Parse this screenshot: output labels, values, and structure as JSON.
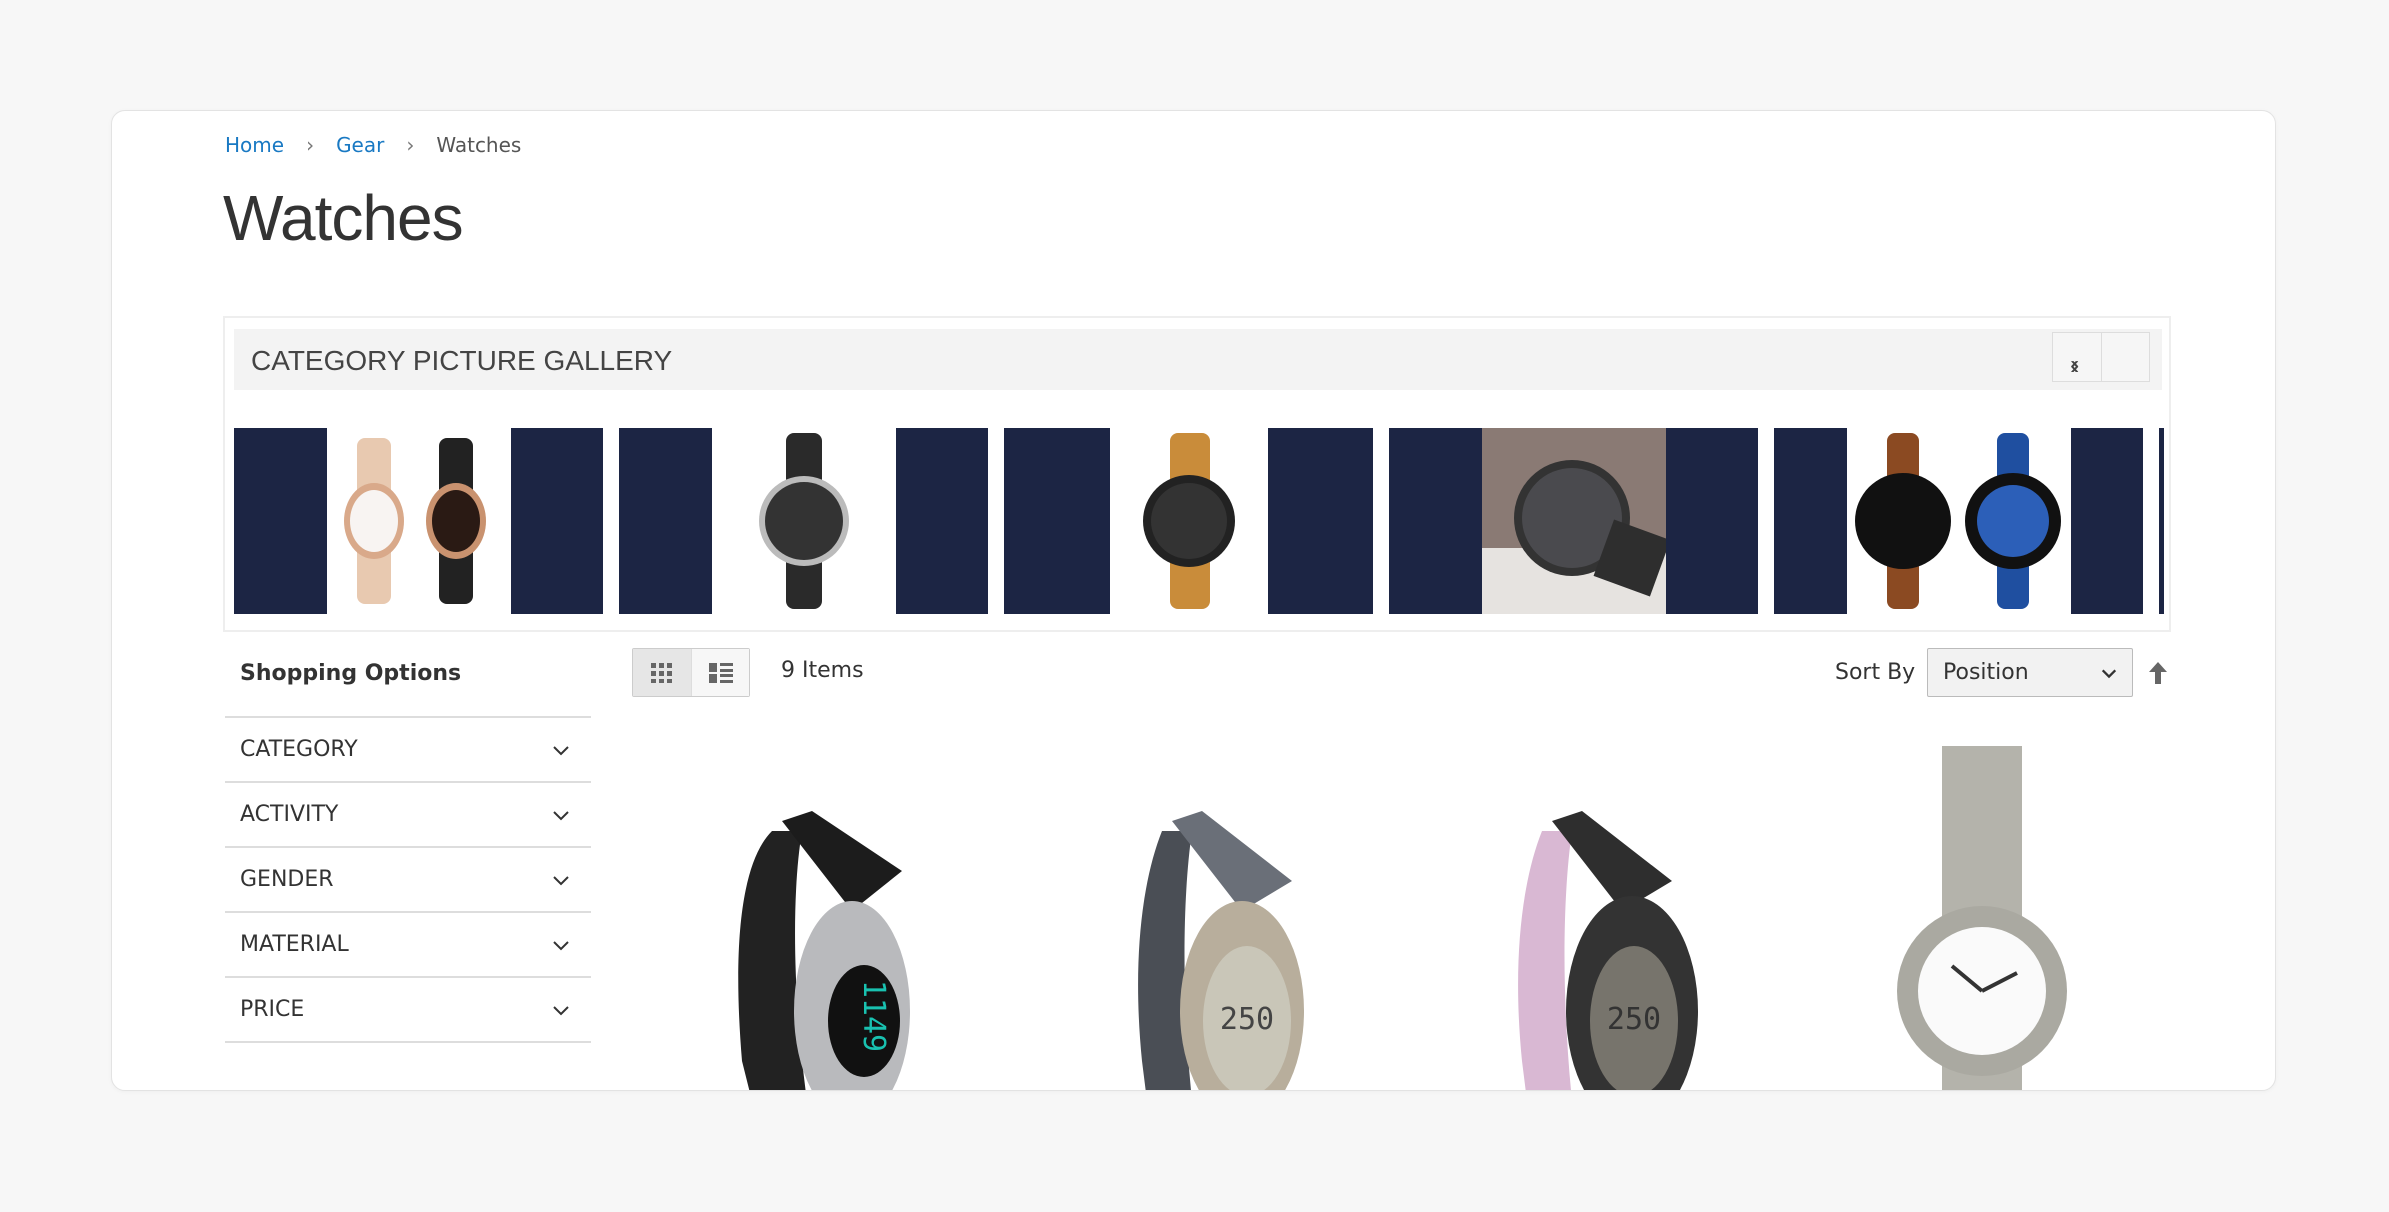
{
  "breadcrumb": [
    {
      "label": "Home",
      "link": true
    },
    {
      "label": "Gear",
      "link": true
    },
    {
      "label": "Watches",
      "link": false
    }
  ],
  "page_title": "Watches",
  "gallery": {
    "title": "CATEGORY PICTURE GALLERY",
    "prev_icon": "chevron-left-icon",
    "next_icon": "chevron-right-icon",
    "slide_bg": "#1c2544",
    "slides": [
      "two ladies bracelet watches",
      "black leather chronograph watch",
      "tan strap chronograph watch",
      "black watch lifestyle photo",
      "brown and blue strap watches"
    ]
  },
  "sidebar": {
    "title": "Shopping Options",
    "filters": [
      {
        "label": "CATEGORY"
      },
      {
        "label": "ACTIVITY"
      },
      {
        "label": "GENDER"
      },
      {
        "label": "MATERIAL"
      },
      {
        "label": "PRICE"
      }
    ]
  },
  "toolbar": {
    "view_modes": [
      "grid",
      "list"
    ],
    "active_mode": "grid",
    "count": "9 Items",
    "sort_label": "Sort By",
    "sort_value": "Position",
    "sort_direction_icon": "arrow-up-icon"
  },
  "colors": {
    "link": "#1979c3",
    "accent_navy": "#1c2544"
  }
}
